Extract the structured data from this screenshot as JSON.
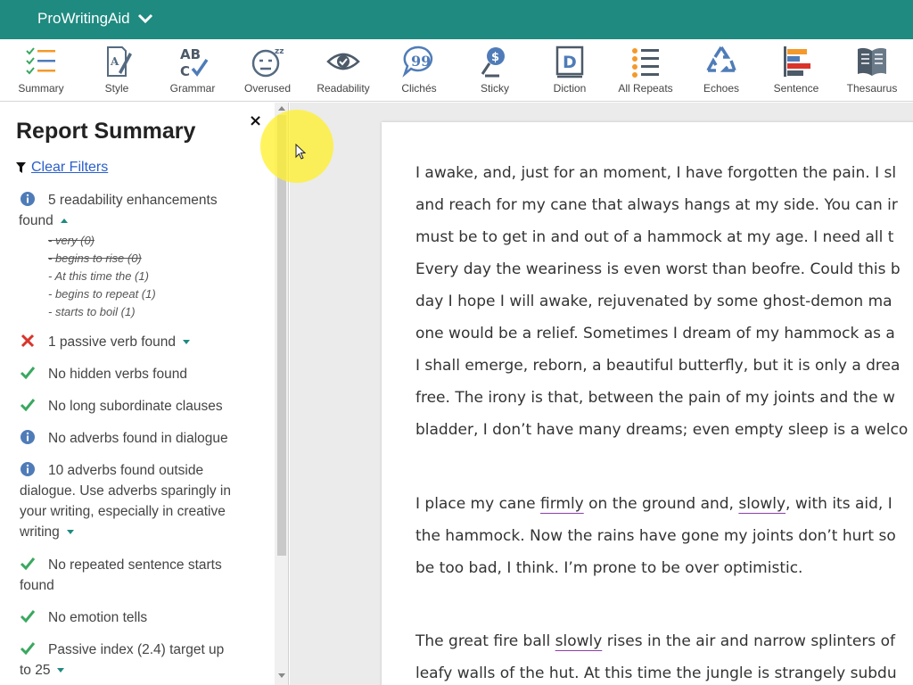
{
  "app": {
    "name": "ProWritingAid"
  },
  "toolbar": {
    "tools": [
      {
        "label": "Summary",
        "icon": "summary-icon"
      },
      {
        "label": "Style",
        "icon": "style-icon"
      },
      {
        "label": "Grammar",
        "icon": "grammar-icon"
      },
      {
        "label": "Overused",
        "icon": "overused-icon"
      },
      {
        "label": "Readability",
        "icon": "readability-icon"
      },
      {
        "label": "Clichés",
        "icon": "cliches-icon"
      },
      {
        "label": "Sticky",
        "icon": "sticky-icon"
      },
      {
        "label": "Diction",
        "icon": "diction-icon"
      },
      {
        "label": "All Repeats",
        "icon": "all-repeats-icon"
      },
      {
        "label": "Echoes",
        "icon": "echoes-icon"
      },
      {
        "label": "Sentence",
        "icon": "sentence-icon"
      },
      {
        "label": "Thesaurus",
        "icon": "thesaurus-icon"
      }
    ]
  },
  "sidebar": {
    "title": "Report Summary",
    "close": "×",
    "clear_filters": "Clear Filters",
    "items": [
      {
        "status": "info",
        "text_1": "5 readability enhancements",
        "text_2": "found"
      },
      {
        "status": "error",
        "text": "1 passive verb found"
      },
      {
        "status": "ok",
        "text": "No hidden verbs found"
      },
      {
        "status": "ok",
        "text": "No long subordinate clauses"
      },
      {
        "status": "info",
        "text": "No adverbs found in dialogue"
      },
      {
        "status": "info",
        "text_1": "10 adverbs found outside",
        "text_2": "dialogue. Use adverbs sparingly in",
        "text_3": "your writing, especially in creative",
        "text_4": "writing"
      },
      {
        "status": "ok",
        "text_1": "No repeated sentence starts",
        "text_2": "found"
      },
      {
        "status": "ok",
        "text": "No emotion tells"
      },
      {
        "status": "ok",
        "text_1": "Passive index (2.4) target up",
        "text_2": "to 25"
      }
    ],
    "subitems": [
      {
        "text": "- very (0)",
        "struck": true
      },
      {
        "text": "- begins to rise (0)",
        "struck": true
      },
      {
        "text": "- At this time the (1)",
        "struck": false
      },
      {
        "text": "- begins to repeat (1)",
        "struck": false
      },
      {
        "text": "- starts to boil (1)",
        "struck": false
      }
    ]
  },
  "editor": {
    "paragraph1": [
      "I awake, and, just for an moment, I have forgotten the pain. I sl",
      "and reach for my cane that always hangs at my side. You can ir",
      "must be to get in and out of a hammock at my age. I need all t",
      "Every day the weariness is even worst than beofre. Could this b",
      "day I hope I will awake, rejuvenated by some ghost-demon ma",
      "one would be a relief. Sometimes I dream of my hammock as a",
      "I shall emerge, reborn, a beautiful butterfly, but it is only a drea",
      "free. The irony is that, between the pain of my joints and the w",
      "bladder, I don’t have many dreams; even empty sleep is a welco"
    ],
    "paragraph2": {
      "l1_a": "I place my cane ",
      "l1_u1": "firmly",
      "l1_b": " on the ground and, ",
      "l1_u2": "slowly",
      "l1_c": ", with its aid, I",
      "l2": "the hammock. Now the rains have gone my joints don’t hurt so",
      "l3": "be too bad, I think. I’m prone to be over optimistic."
    },
    "paragraph3": {
      "l1_a": "The great fire ball ",
      "l1_u": "slowly",
      "l1_b": " rises in the air and narrow splinters of",
      "l2": "leafy walls of the hut. At this time the jungle is strangely subdu"
    }
  },
  "colors": {
    "brand": "#1f8a80",
    "ok": "#3aa860",
    "error": "#d9342b",
    "info": "#4f7cb8",
    "underline": "#8a3fa6"
  }
}
